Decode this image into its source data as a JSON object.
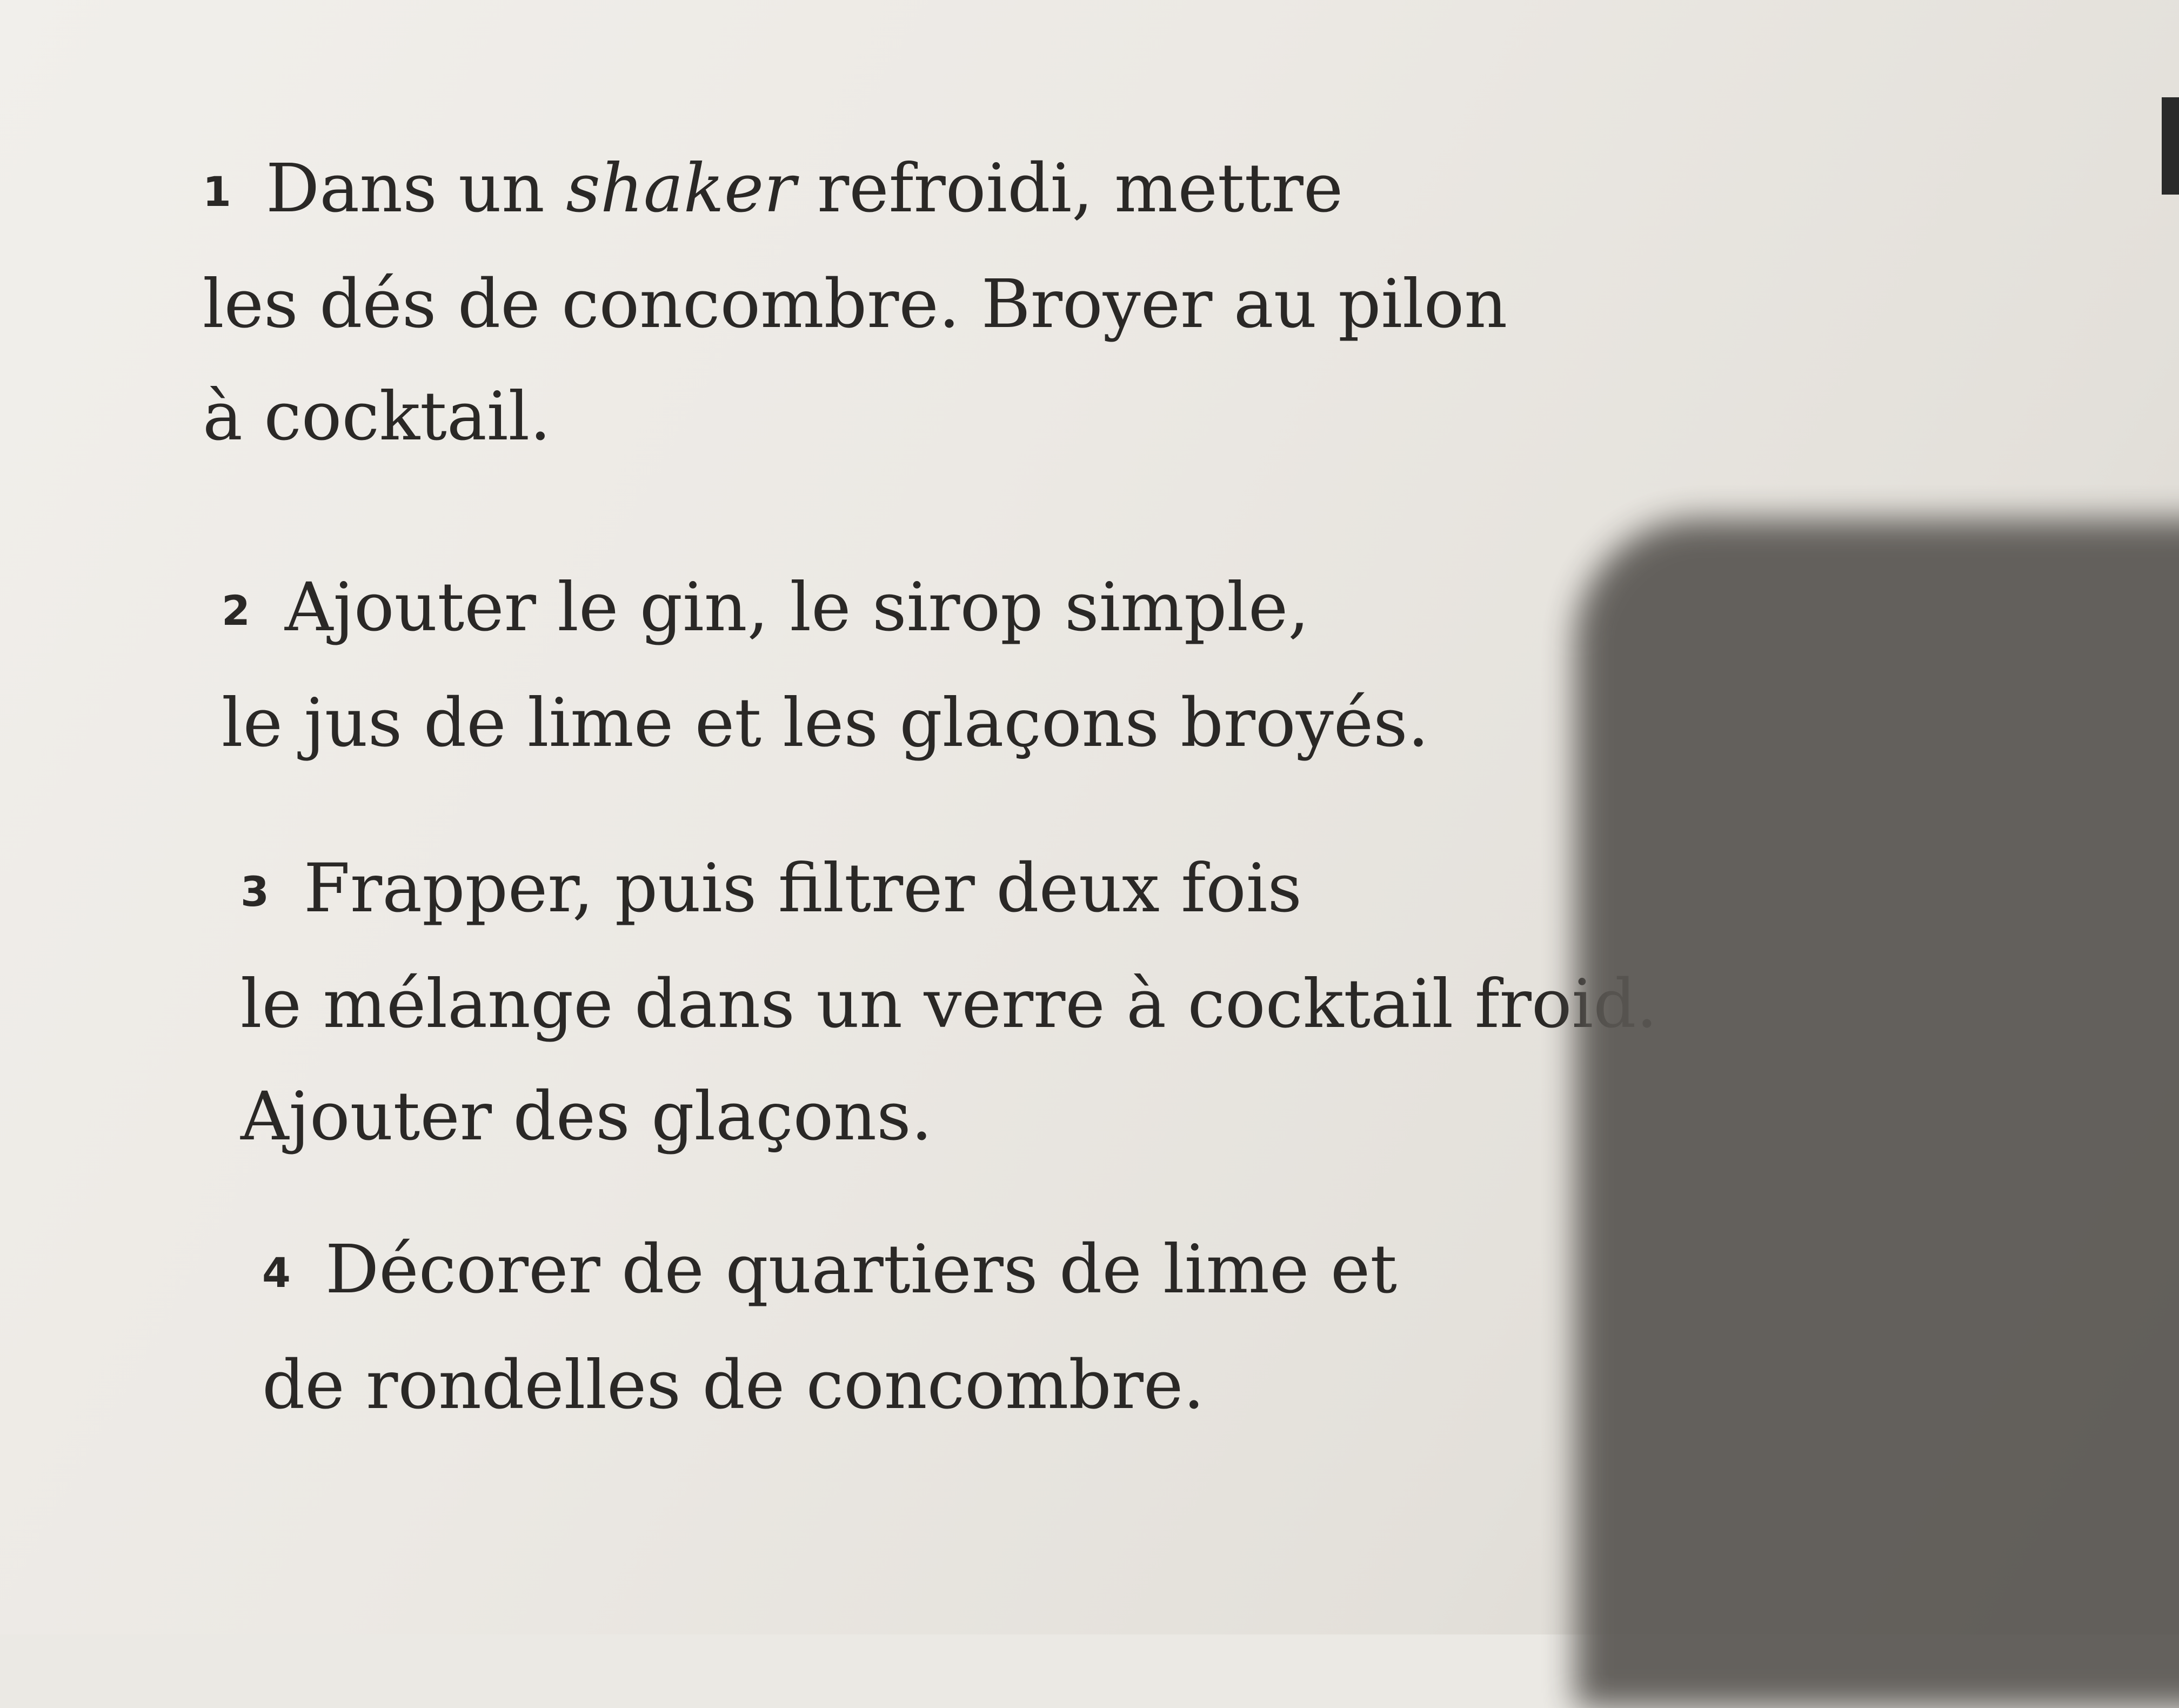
{
  "steps": [
    {
      "number": "1",
      "lines": [
        {
          "before": "Dans un ",
          "italic": "shaker",
          "after": " refroidi, mettre"
        },
        "les dés de concombre. Broyer au pilon",
        "à cocktail."
      ]
    },
    {
      "number": "2",
      "lines": [
        "Ajouter le gin, le sirop simple,",
        "le jus de lime et les glaçons broyés."
      ]
    },
    {
      "number": "3",
      "lines": [
        "Frapper, puis filtrer deux fois",
        "le mélange dans un verre à cocktail froid.",
        "Ajouter des glaçons."
      ]
    },
    {
      "number": "4",
      "lines": [
        "Décorer de quartiers de lime et",
        "de rondelles de concombre."
      ]
    }
  ]
}
